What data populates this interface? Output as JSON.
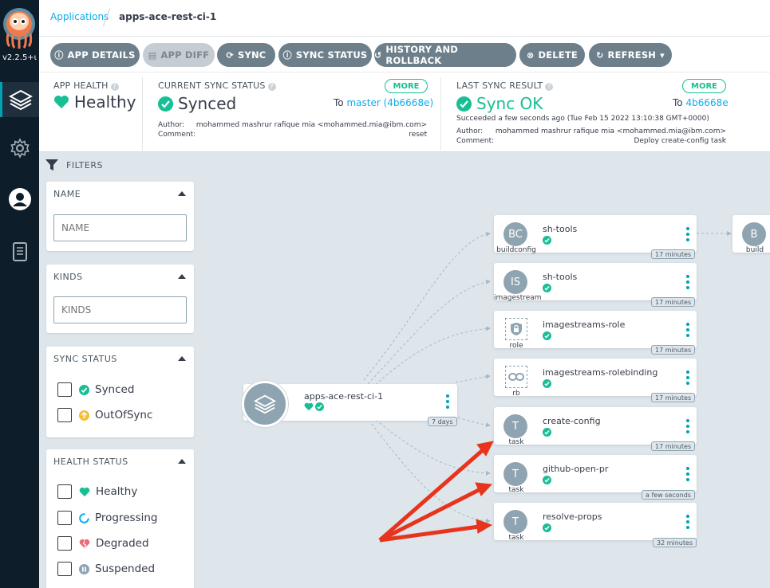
{
  "nav": {
    "version": "v2.2.5+ι",
    "items": [
      {
        "name": "applications",
        "icon": "layers-icon"
      },
      {
        "name": "settings",
        "icon": "gear-icon"
      },
      {
        "name": "user",
        "icon": "user-icon"
      },
      {
        "name": "docs",
        "icon": "book-icon"
      }
    ]
  },
  "breadcrumb": {
    "root": "Applications",
    "current": "apps-ace-rest-ci-1"
  },
  "toolbar": {
    "app_details": "APP DETAILS",
    "app_diff": "APP DIFF",
    "sync": "SYNC",
    "sync_status": "SYNC STATUS",
    "history": "HISTORY AND ROLLBACK",
    "delete": "DELETE",
    "refresh": "REFRESH"
  },
  "status": {
    "health_label": "APP HEALTH",
    "health_value": "Healthy",
    "sync_label": "CURRENT SYNC STATUS",
    "sync_value": "Synced",
    "sync_more": "MORE",
    "sync_to_prefix": "To",
    "sync_to_ref": "master (4b6668e)",
    "sync_author_label": "Author:",
    "sync_author": "mohammed mashrur rafique mia <mohammed.mia@ibm.com> -",
    "sync_comment_label": "Comment:",
    "sync_comment": "reset",
    "last_label": "LAST SYNC RESULT",
    "last_value": "Sync OK",
    "last_more": "MORE",
    "last_to_prefix": "To",
    "last_to_ref": "4b6668e",
    "last_when": "Succeeded a few seconds ago (Tue Feb 15 2022 13:10:38 GMT+0000)",
    "last_author_label": "Author:",
    "last_author": "mohammed mashrur rafique mia <mohammed.mia@ibm.com> -",
    "last_comment_label": "Comment:",
    "last_comment": "Deploy create-config task"
  },
  "filters": {
    "title": "FILTERS",
    "name_head": "NAME",
    "name_placeholder": "NAME",
    "kinds_head": "KINDS",
    "kinds_placeholder": "KINDS",
    "sync_head": "SYNC STATUS",
    "sync_options": [
      "Synced",
      "OutOfSync"
    ],
    "health_head": "HEALTH STATUS",
    "health_options": [
      "Healthy",
      "Progressing",
      "Degraded",
      "Suspended"
    ]
  },
  "graph": {
    "root": {
      "name": "apps-ace-rest-ci-1",
      "age": "7 days"
    },
    "nodes": [
      {
        "abbr": "BC",
        "kind": "buildconfig",
        "name": "sh-tools",
        "age": "17 minutes"
      },
      {
        "abbr": "IS",
        "kind": "imagestream",
        "name": "sh-tools",
        "age": "17 minutes"
      },
      {
        "abbr": "",
        "kind": "role",
        "name": "imagestreams-role",
        "age": "17 minutes"
      },
      {
        "abbr": "",
        "kind": "rb",
        "name": "imagestreams-rolebinding",
        "age": "17 minutes"
      },
      {
        "abbr": "T",
        "kind": "task",
        "name": "create-config",
        "age": "17 minutes"
      },
      {
        "abbr": "T",
        "kind": "task",
        "name": "github-open-pr",
        "age": "a few seconds"
      },
      {
        "abbr": "T",
        "kind": "task",
        "name": "resolve-props",
        "age": "32 minutes"
      }
    ],
    "build": {
      "abbr": "B",
      "kind": "build"
    }
  },
  "colors": {
    "accent": "#00a2b3",
    "green": "#18be94",
    "button": "#6d7f8b",
    "arrow": "#e8341c"
  }
}
